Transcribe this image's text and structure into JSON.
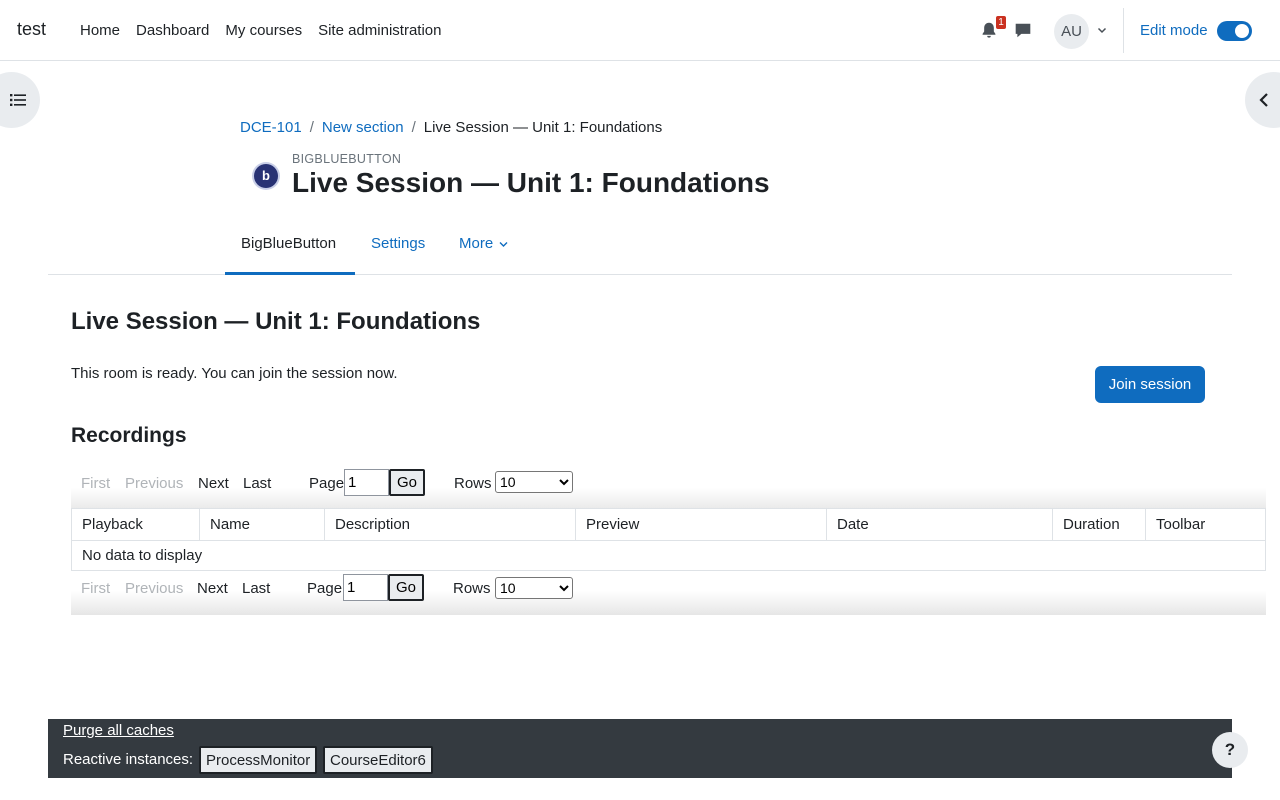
{
  "navbar": {
    "brand": "test",
    "links": [
      "Home",
      "Dashboard",
      "My courses",
      "Site administration"
    ],
    "notification_count": "1",
    "avatar_initials": "AU",
    "edit_mode_label": "Edit mode",
    "edit_mode_on": true
  },
  "breadcrumb": {
    "items": [
      "DCE-101",
      "New section",
      "Live Session — Unit 1: Foundations"
    ],
    "separator": "/"
  },
  "header": {
    "module_type": "BIGBLUEBUTTON",
    "module_icon_glyph": "b",
    "title": "Live Session — Unit 1: Foundations"
  },
  "secondary_nav": {
    "tabs": [
      "BigBlueButton",
      "Settings",
      "More"
    ]
  },
  "main": {
    "title": "Live Session — Unit 1: Foundations",
    "room_status": "This room is ready. You can join the session now.",
    "join_button": "Join session",
    "recordings_title": "Recordings"
  },
  "recordings": {
    "pager": {
      "first": "First",
      "previous": "Previous",
      "next": "Next",
      "last": "Last",
      "page_label": "Page",
      "page_value": "1",
      "go": "Go",
      "rows_label": "Rows",
      "rows_value": "10"
    },
    "columns": [
      "Playback",
      "Name",
      "Description",
      "Preview",
      "Date",
      "Duration",
      "Toolbar"
    ],
    "empty_message": "No data to display"
  },
  "footer": {
    "purge_link": "Purge all caches",
    "reactive_label": "Reactive instances:",
    "reactive_buttons": [
      "ProcessMonitor",
      "CourseEditor6"
    ],
    "help_glyph": "?"
  },
  "colors": {
    "accent": "#0f6cbf",
    "footer_bg": "#343a40",
    "badge": "#ca3120"
  }
}
